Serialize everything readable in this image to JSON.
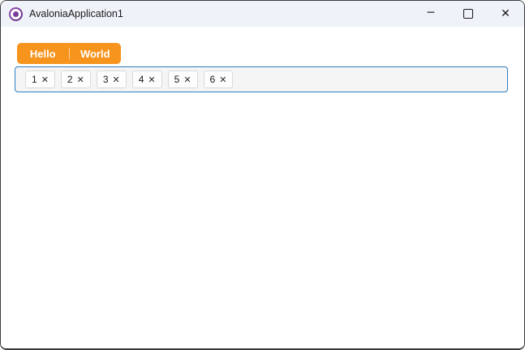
{
  "titlebar": {
    "title": "AvaloniaApplication1",
    "icons": {
      "minimize": "─",
      "close": "✕"
    }
  },
  "tabs": {
    "items": [
      {
        "label": "Hello"
      },
      {
        "label": "World"
      }
    ]
  },
  "chip_input": {
    "chips": [
      {
        "label": "1",
        "close_icon": "✕"
      },
      {
        "label": "2",
        "close_icon": "✕"
      },
      {
        "label": "3",
        "close_icon": "✕"
      },
      {
        "label": "4",
        "close_icon": "✕"
      },
      {
        "label": "5",
        "close_icon": "✕"
      },
      {
        "label": "6",
        "close_icon": "✕"
      }
    ]
  },
  "colors": {
    "accent_orange": "#F7941D",
    "focus_border_blue": "#2E7DC0",
    "titlebar_bg": "#EFF3F9",
    "window_border": "#3B3B3B",
    "avalonia_purple": "#7B3591"
  }
}
